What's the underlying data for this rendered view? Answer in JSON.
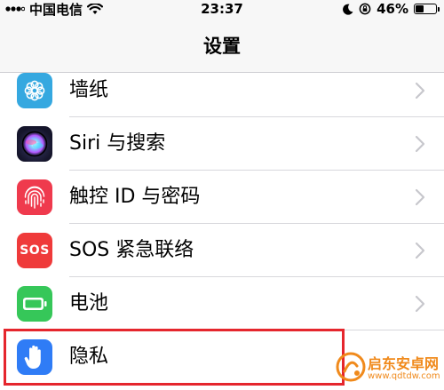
{
  "status": {
    "carrier": "中国电信",
    "time": "23:37",
    "battery_percent": "46%",
    "battery_level": 0.46
  },
  "nav": {
    "title": "设置"
  },
  "rows": [
    {
      "label": "墙纸",
      "icon": "wallpaper-flower-icon",
      "color": "#35a8e0"
    },
    {
      "label": "Siri 与搜索",
      "icon": "siri-icon",
      "color": "#1c1c3a"
    },
    {
      "label": "触控 ID 与密码",
      "icon": "fingerprint-icon",
      "color": "#ef3a4d"
    },
    {
      "label": "SOS 紧急联络",
      "icon": "sos-icon",
      "color": "#ef3a3a",
      "icon_text": "SOS"
    },
    {
      "label": "电池",
      "icon": "battery-icon",
      "color": "#36c759"
    },
    {
      "label": "隐私",
      "icon": "hand-icon",
      "color": "#2f7cf6"
    }
  ],
  "watermark": {
    "text": "启东安卓网",
    "url": "www.qdtdw.com",
    "color": "#f08a1c"
  }
}
